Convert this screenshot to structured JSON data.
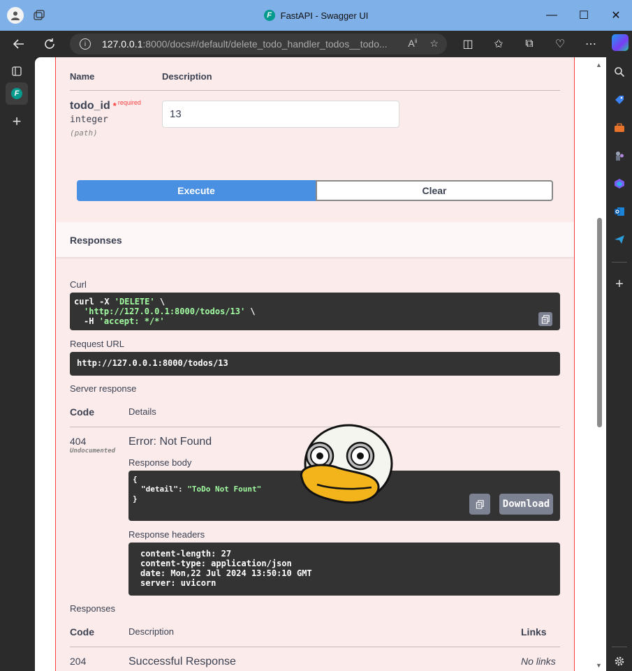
{
  "browser": {
    "window_title": "FastAPI - Swagger UI",
    "favicon_letter": "F",
    "url_host": "127.0.0.1",
    "url_path": ":8000/docs#/default/delete_todo_handler_todos__todo...",
    "winctl": {
      "minimize": "—",
      "maximize": "☐",
      "close": "✕"
    }
  },
  "parameters": {
    "col_name": "Name",
    "col_description": "Description",
    "param_name": "todo_id",
    "required_star": "*",
    "required_label": "required",
    "param_type": "integer",
    "param_in": "(path)",
    "value": "13"
  },
  "actions": {
    "execute": "Execute",
    "clear": "Clear"
  },
  "responses_section": {
    "title": "Responses",
    "curl_label": "Curl",
    "curl_line1_cmd": "curl -X ",
    "curl_line1_method": "'DELETE'",
    "curl_line1_end": " \\",
    "curl_line2_url": "'http://127.0.0.1:8000/todos/13'",
    "curl_line2_end": " \\",
    "curl_line3_flag": "-H ",
    "curl_line3_header": "'accept: */*'",
    "request_url_label": "Request URL",
    "request_url": "http://127.0.0.1:8000/todos/13",
    "server_response_label": "Server response",
    "col_code": "Code",
    "col_details": "Details",
    "code": "404",
    "undocumented": "Undocumented",
    "error_title": "Error: Not Found",
    "response_body_label": "Response body",
    "body_open": "{",
    "body_key": "\"detail\"",
    "body_colon": ": ",
    "body_value": "\"ToDo Not Fount\"",
    "body_close": "}",
    "download": "Download",
    "response_headers_label": "Response headers",
    "headers": [
      "content-length: 27",
      "content-type: application/json",
      "date: Mon,22 Jul 2024 13:50:10 GMT",
      "server: uvicorn"
    ]
  },
  "documented_responses": {
    "title": "Responses",
    "col_code": "Code",
    "col_description": "Description",
    "col_links": "Links",
    "rows": [
      {
        "code": "204",
        "description": "Successful Response",
        "links": "No links"
      }
    ]
  },
  "colors": {
    "delete_border": "#f93e3e",
    "delete_bg": "#fbebeb",
    "execute_blue": "#4990e2",
    "code_bg": "#333333",
    "string_green": "#a2fca2"
  }
}
